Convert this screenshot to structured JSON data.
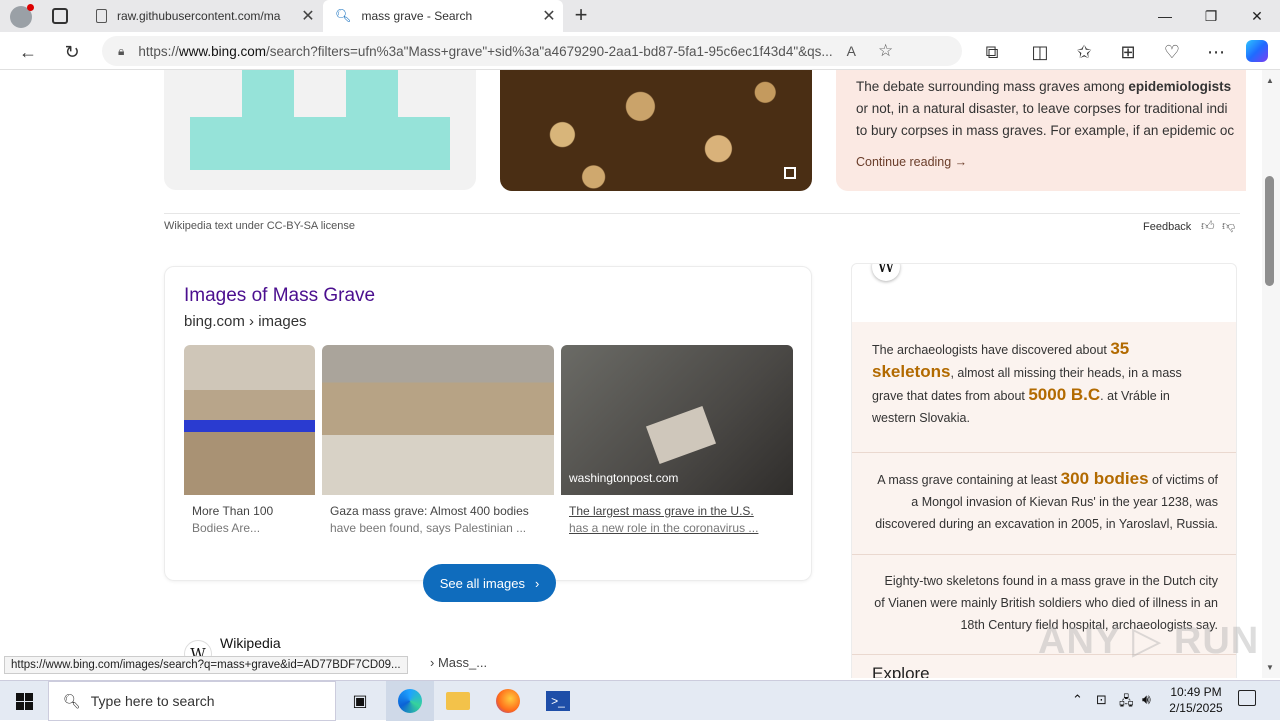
{
  "browser": {
    "tabs": [
      {
        "title": "raw.githubusercontent.com/ma",
        "icon": "document-icon"
      },
      {
        "title": "mass grave - Search",
        "icon": "search-icon"
      }
    ],
    "url_prefix": "https://",
    "url_host": "www.bing.com",
    "url_rest": "/search?filters=ufn%3a\"Mass+grave\"+sid%3a\"a4679290-2aa1-bd87-5fa1-95c6ec1f43d4\"&qs...",
    "status_url": "https://www.bing.com/images/search?q=mass+grave&id=AD77BDF7CD09..."
  },
  "wiki_card": {
    "text_prefix": "The debate surrounding mass graves among ",
    "text_bold": "epidemiologists",
    "line2": "or not, in a natural disaster, to leave corpses for traditional indi",
    "line3": "to bury corpses in mass graves. For example, if an epidemic oc",
    "continue": "Continue reading →",
    "license": "Wikipedia text under CC-BY-SA license",
    "feedback": "Feedback"
  },
  "images_section": {
    "title": "Images of Mass Grave",
    "source": "bing.com › images",
    "items": [
      {
        "caption1": "More Than 100",
        "caption2": "Bodies Are..."
      },
      {
        "caption1": "Gaza mass grave: Almost 400 bodies",
        "caption2": "have been found, says Palestinian ..."
      },
      {
        "caption1": "The largest mass grave in the U.S.",
        "caption2": "has a new role in the coronavirus ...",
        "overlay": "washingtonpost.com"
      }
    ],
    "see_all": "See all images"
  },
  "wikipedia_result": {
    "title": "Wikipedia",
    "crumb": "› Mass_..."
  },
  "facts": [
    {
      "a": "The archaeologists have discovered about ",
      "h1": "35 skeletons",
      "b": ", almost all missing their heads, in a mass grave that dates from about ",
      "h2": "5000 B.C",
      "c": ". at Vráble in western Slovakia."
    },
    {
      "a": "A mass grave containing at least ",
      "h1": "300 bodies",
      "b": " of victims of a Mongol invasion of Kievan Rus' in the year 1238, was discovered during an excavation in 2005, in Yaroslavl, Russia."
    },
    {
      "a": "Eighty-two skeletons found in a mass grave in the Dutch city of Vianen were mainly British soldiers who died of illness in an 18th Century field hospital, archaeologists say."
    }
  ],
  "facts_next": "Explore",
  "taskbar": {
    "search_placeholder": "Type here to search",
    "time": "10:49 PM",
    "date": "2/15/2025"
  },
  "colors": {
    "accent": "#0f6cbd",
    "link_purple": "#4b0f8f",
    "highlight": "#b26a00",
    "teal": "#96e3d9"
  }
}
